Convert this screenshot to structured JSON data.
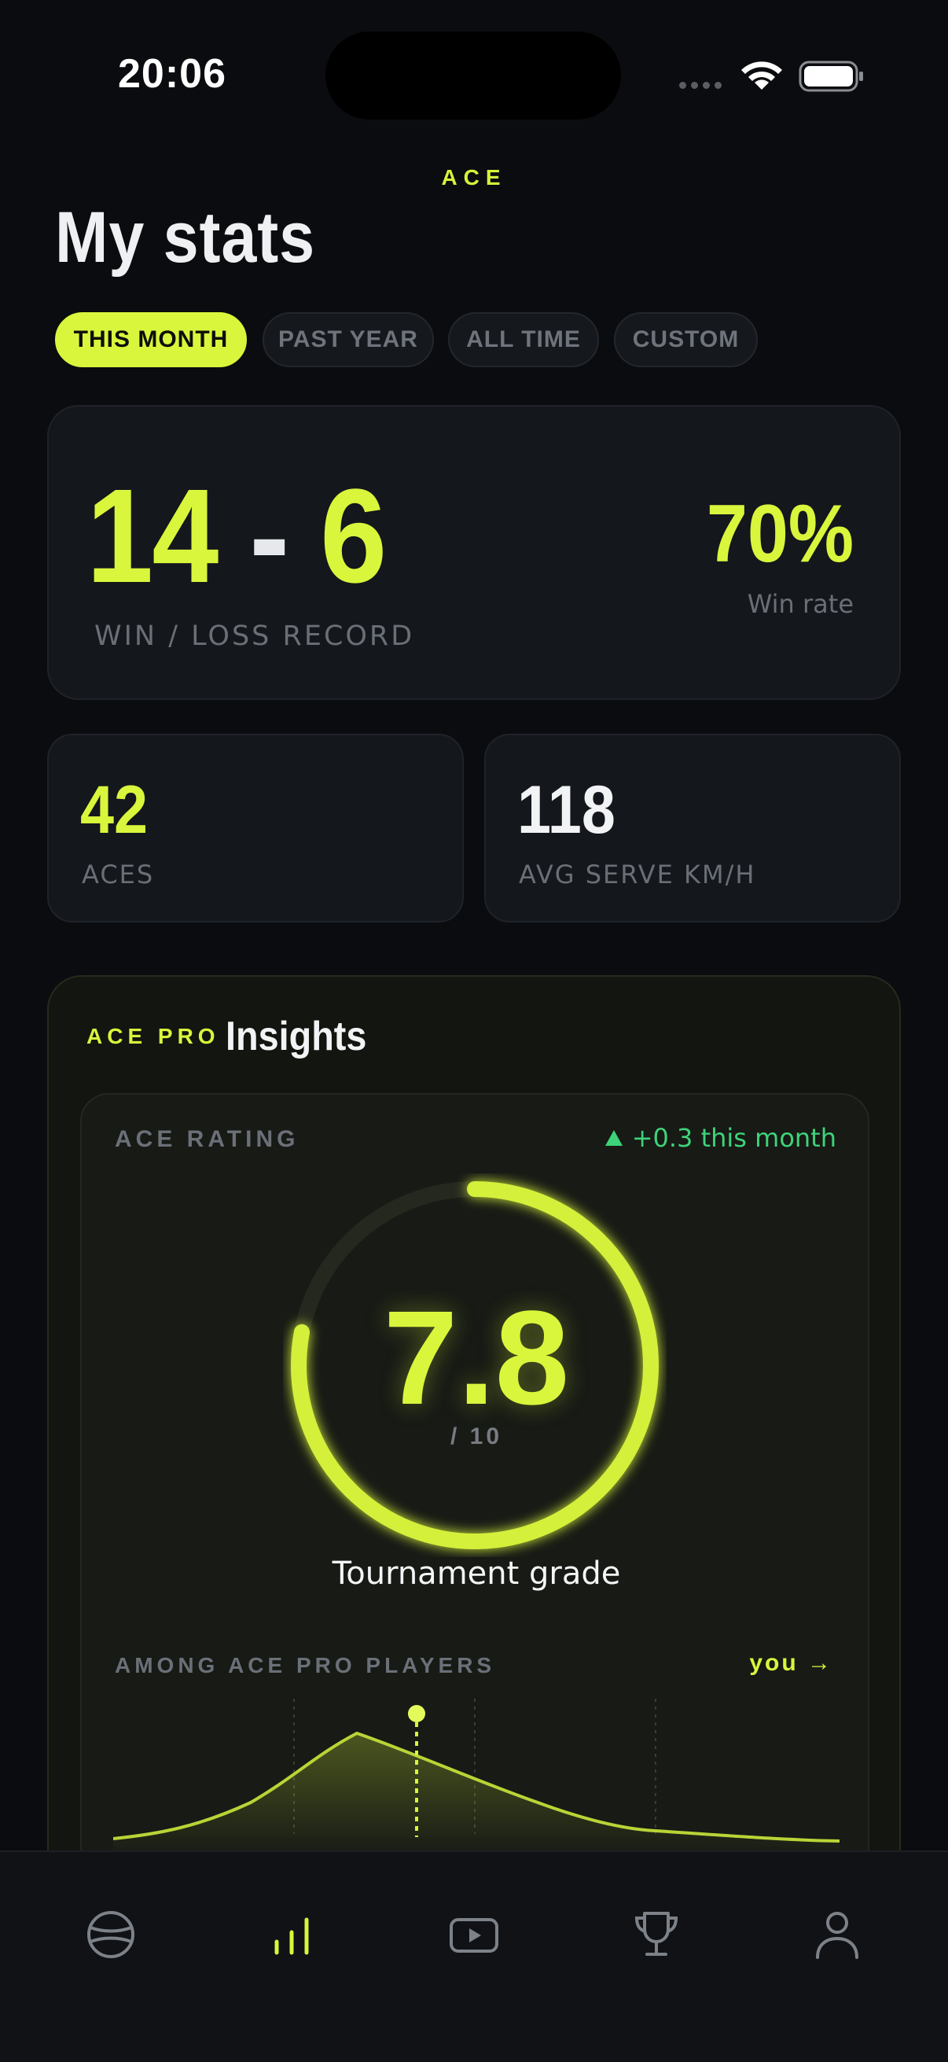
{
  "status_bar": {
    "time": "20:06"
  },
  "header": {
    "brand": "ACE",
    "title": "My stats"
  },
  "tabs": [
    {
      "label": "THIS MONTH",
      "active": true
    },
    {
      "label": "PAST YEAR",
      "active": false
    },
    {
      "label": "ALL TIME",
      "active": false
    },
    {
      "label": "CUSTOM",
      "active": false
    }
  ],
  "record": {
    "wins": "14",
    "separator": "-",
    "losses": "6",
    "label": "WIN / LOSS RECORD",
    "win_rate": "70%",
    "win_rate_label": "Win rate"
  },
  "stats": [
    {
      "value": "42",
      "label": "ACES"
    },
    {
      "value": "118",
      "label": "AVG SERVE KM/H"
    }
  ],
  "insights": {
    "tag": "ACE PRO",
    "title": "Insights",
    "rating_label": "ACE RATING",
    "rating_delta": "+0.3 this month",
    "rating_value": "7.8",
    "rating_scale": "/ 10",
    "rating_fraction": 0.78,
    "grade": "Tournament grade",
    "among_label": "AMONG ACE PRO PLAYERS",
    "you_label": "you →"
  },
  "nav": [
    {
      "icon": "tennis-ball-icon",
      "active": false
    },
    {
      "icon": "stats-bars-icon",
      "active": true
    },
    {
      "icon": "video-play-icon",
      "active": false
    },
    {
      "icon": "trophy-icon",
      "active": false
    },
    {
      "icon": "profile-icon",
      "active": false
    }
  ],
  "colors": {
    "accent": "#d9f63c",
    "background": "#0b0c0f",
    "card": "#14171c",
    "positive": "#3ed37a",
    "muted": "#6a6f77"
  }
}
